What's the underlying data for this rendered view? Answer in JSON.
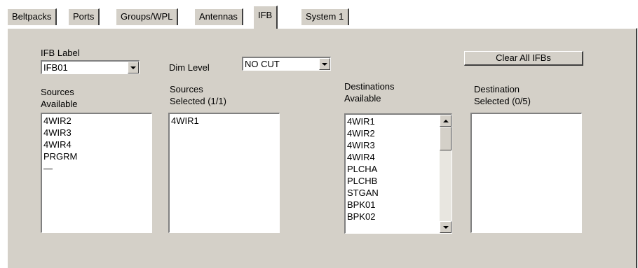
{
  "tabs": [
    "Beltpacks",
    "Ports",
    "Groups/WPL",
    "Antennas",
    "IFB",
    "System 1"
  ],
  "active_tab": "IFB",
  "ifb_label": {
    "label": "IFB Label",
    "value": "IFB01"
  },
  "dim_level": {
    "label": "Dim Level",
    "value": "NO CUT"
  },
  "clear_button": "Clear All IFBs",
  "sources_available": {
    "label_line1": "Sources",
    "label_line2": "Available",
    "items": [
      "4WIR2",
      "4WIR3",
      "4WIR4",
      "PRGRM",
      "—"
    ]
  },
  "sources_selected": {
    "label_line1": "Sources",
    "label_line2": "Selected (1/1)",
    "items": [
      "4WIR1"
    ]
  },
  "destinations_available": {
    "label_line1": "Destinations",
    "label_line2": "Available",
    "items": [
      "4WIR1",
      "4WIR2",
      "4WIR3",
      "4WIR4",
      "PLCHA",
      "PLCHB",
      "STGAN",
      "BPK01",
      "BPK02"
    ],
    "scroll_position": 0.0
  },
  "destination_selected": {
    "label_line1": "Destination",
    "label_line2": "Selected (0/5)",
    "items": []
  }
}
